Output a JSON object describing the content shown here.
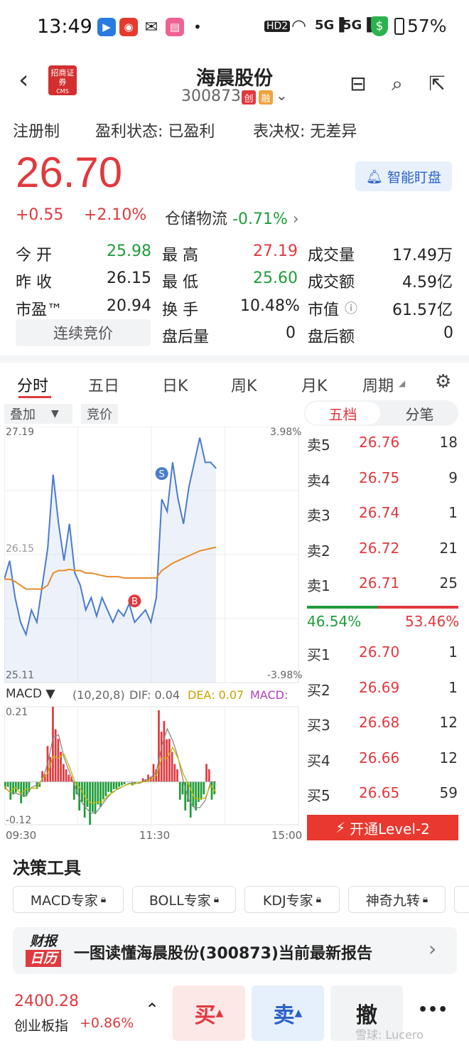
{
  "statusbar": {
    "time": "13:49",
    "battery": "57%",
    "network": "5G",
    "hd": "HD2"
  },
  "header": {
    "title": "海晨股份",
    "code": "300873",
    "tag1": "创",
    "tag2": "融",
    "broker_logo": "招商证券",
    "broker_sub": "CMS"
  },
  "info": {
    "reg": "注册制",
    "profit": "盈利状态: 已盈利",
    "vote": "表决权: 无差异"
  },
  "price": {
    "last": "26.70",
    "change": "+0.55",
    "pct": "+2.10%",
    "sector": "仓储物流",
    "sector_pct": "-0.71%",
    "smart_label": "智能盯盘"
  },
  "quote": {
    "open_l": "今  开",
    "open": "25.98",
    "high_l": "最  高",
    "high": "27.19",
    "vol_l": "成交量",
    "vol": "17.49万",
    "prev_l": "昨  收",
    "prev": "26.15",
    "low_l": "最  低",
    "low": "25.60",
    "amt_l": "成交额",
    "amt": "4.59亿",
    "pe_l": "市盈™",
    "pe": "20.94",
    "turn_l": "换  手",
    "turn": "10.48%",
    "mcap_l": "市值",
    "mcap": "61.57亿",
    "cont": "连续竞价",
    "after_vol_l": "盘后量",
    "after_vol": "0",
    "after_amt_l": "盘后额",
    "after_amt": "0"
  },
  "tabs": [
    "分时",
    "五日",
    "日K",
    "周K",
    "月K",
    "周期"
  ],
  "subtabs": {
    "overlay": "叠加",
    "auction": "竞价",
    "orderbook": "五档",
    "ticks": "分笔"
  },
  "chart": {
    "ymax": "27.19",
    "ymin": "25.11",
    "ymid": "26.15",
    "pmax": "3.98%",
    "pmin": "-3.98%",
    "t0": "09:30",
    "t1": "11:30",
    "t2": "15:00",
    "macd_label": "MACD",
    "macd_params": "(10,20,8)",
    "dif": "DIF: 0.04",
    "dea": "DEA: 0.07",
    "macd_val": "MACD:",
    "mmax": "0.21",
    "mmin": "-0.12",
    "mark_s": "S",
    "mark_b": "B"
  },
  "chart_data": {
    "type": "line",
    "price_series": [
      25.95,
      26.1,
      25.8,
      25.6,
      25.5,
      25.7,
      25.6,
      25.9,
      26.2,
      26.8,
      26.4,
      26.1,
      26.4,
      26.0,
      25.9,
      25.7,
      25.8,
      25.65,
      25.8,
      25.7,
      25.6,
      25.7,
      25.65,
      25.75,
      25.6,
      25.65,
      25.7,
      25.6,
      25.8,
      26.6,
      26.5,
      26.9,
      26.6,
      26.4,
      26.7,
      26.9,
      27.1,
      26.9,
      26.9,
      26.85
    ],
    "avg_series": [
      25.95,
      25.95,
      25.93,
      25.9,
      25.87,
      25.87,
      25.87,
      25.87,
      25.9,
      26.0,
      26.02,
      26.02,
      26.03,
      26.02,
      26.02,
      26.0,
      26.0,
      25.99,
      25.98,
      25.97,
      25.97,
      25.97,
      25.96,
      25.96,
      25.96,
      25.96,
      25.96,
      25.96,
      25.96,
      26.02,
      26.05,
      26.08,
      26.1,
      26.12,
      26.14,
      26.16,
      26.18,
      26.19,
      26.2,
      26.21
    ],
    "macd_series": [
      -0.02,
      -0.05,
      -0.03,
      -0.06,
      -0.04,
      0.0,
      -0.02,
      0.03,
      0.1,
      0.21,
      0.12,
      0.05,
      0.02,
      -0.05,
      -0.08,
      -0.1,
      -0.12,
      -0.09,
      -0.07,
      -0.04,
      -0.03,
      -0.02,
      -0.01,
      0.0,
      -0.01,
      0.0,
      0.01,
      0.02,
      0.05,
      0.2,
      0.17,
      0.12,
      0.05,
      -0.05,
      -0.08,
      -0.1,
      -0.08,
      -0.05,
      0.05,
      -0.05
    ],
    "ylim": [
      25.11,
      27.19
    ]
  },
  "orderbook": {
    "asks": [
      {
        "l": "卖5",
        "p": "26.76",
        "v": "18"
      },
      {
        "l": "卖4",
        "p": "26.75",
        "v": "9"
      },
      {
        "l": "卖3",
        "p": "26.74",
        "v": "1"
      },
      {
        "l": "卖2",
        "p": "26.72",
        "v": "21"
      },
      {
        "l": "卖1",
        "p": "26.71",
        "v": "25"
      }
    ],
    "buy_pct": "46.54%",
    "sell_pct": "53.46%",
    "buy_ratio": 0.4654,
    "bids": [
      {
        "l": "买1",
        "p": "26.70",
        "v": "1"
      },
      {
        "l": "买2",
        "p": "26.69",
        "v": "1"
      },
      {
        "l": "买3",
        "p": "26.68",
        "v": "12"
      },
      {
        "l": "买4",
        "p": "26.66",
        "v": "12"
      },
      {
        "l": "买5",
        "p": "26.65",
        "v": "59"
      }
    ],
    "level2": "开通Level-2"
  },
  "tools": {
    "title": "决策工具",
    "items": [
      "MACD专家",
      "BOLL专家",
      "KDJ专家",
      "神奇九转"
    ]
  },
  "report": {
    "badge1": "财报",
    "badge2": "日历",
    "text": "一图读懂海晨股份(300873)当前最新报告"
  },
  "bottom": {
    "index_val": "2400.28",
    "index_name": "创业板指",
    "index_pct": "+0.86%",
    "buy": "买",
    "sell": "卖",
    "cancel": "撤",
    "more": "•••",
    "watermark": "雪球: Lucero"
  },
  "colors": {
    "up": "#e0393e",
    "down": "#1f9d3a",
    "line": "#4a7bd0",
    "avg": "#e88a2c"
  }
}
